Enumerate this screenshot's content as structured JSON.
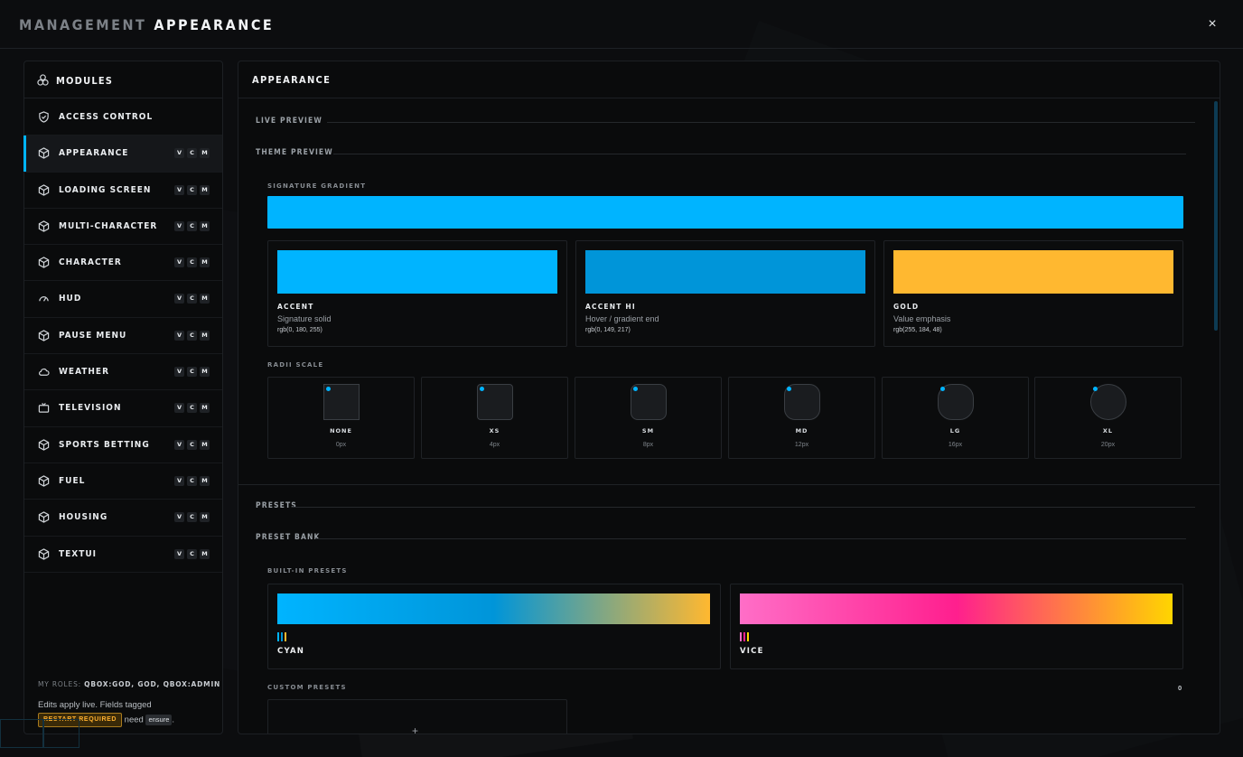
{
  "window": {
    "title_prefix": "MANAGEMENT",
    "title_main": "APPEARANCE",
    "close_label": "×"
  },
  "sidebar": {
    "header": "MODULES",
    "items": [
      {
        "label": "ACCESS CONTROL",
        "icon": "shield-icon",
        "badges": []
      },
      {
        "label": "APPEARANCE",
        "icon": "cube-icon",
        "badges": [
          "V",
          "C",
          "M"
        ],
        "active": true
      },
      {
        "label": "LOADING SCREEN",
        "icon": "cube-icon",
        "badges": [
          "V",
          "C",
          "M"
        ]
      },
      {
        "label": "MULTI-CHARACTER",
        "icon": "cube-icon",
        "badges": [
          "V",
          "C",
          "M"
        ]
      },
      {
        "label": "CHARACTER",
        "icon": "cube-icon",
        "badges": [
          "V",
          "C",
          "M"
        ]
      },
      {
        "label": "HUD",
        "icon": "gauge-icon",
        "badges": [
          "V",
          "C",
          "M"
        ]
      },
      {
        "label": "PAUSE MENU",
        "icon": "cube-icon",
        "badges": [
          "V",
          "C",
          "M"
        ]
      },
      {
        "label": "WEATHER",
        "icon": "cloud-icon",
        "badges": [
          "V",
          "C",
          "M"
        ]
      },
      {
        "label": "TELEVISION",
        "icon": "tv-icon",
        "badges": [
          "V",
          "C",
          "M"
        ]
      },
      {
        "label": "SPORTS BETTING",
        "icon": "cube-icon",
        "badges": [
          "V",
          "C",
          "M"
        ]
      },
      {
        "label": "FUEL",
        "icon": "cube-icon",
        "badges": [
          "V",
          "C",
          "M"
        ]
      },
      {
        "label": "HOUSING",
        "icon": "cube-icon",
        "badges": [
          "V",
          "C",
          "M"
        ]
      },
      {
        "label": "TEXTUI",
        "icon": "cube-icon",
        "badges": [
          "V",
          "C",
          "M"
        ]
      }
    ],
    "roles_label": "MY ROLES:",
    "roles_value": "QBOX:GOD, GOD, QBOX:ADMIN",
    "note_text": "Edits apply live. Fields tagged",
    "restart_badge": "RESTART REQUIRED",
    "note_need": "need",
    "ensure_code": "ensure",
    "note_end": "."
  },
  "main": {
    "header": "APPEARANCE",
    "sections": {
      "live_preview": "LIVE PREVIEW",
      "theme_preview": "THEME PREVIEW",
      "presets": "PRESETS",
      "preset_bank": "PRESET BANK"
    },
    "signature_gradient_label": "SIGNATURE GRADIENT",
    "signature_gradient_color": "#00b4ff",
    "swatches": [
      {
        "name": "ACCENT",
        "desc": "Signature solid",
        "rgb": "rgb(0, 180, 255)",
        "color": "#00b4ff"
      },
      {
        "name": "ACCENT HI",
        "desc": "Hover / gradient end",
        "rgb": "rgb(0, 149, 217)",
        "color": "#0095d9"
      },
      {
        "name": "GOLD",
        "desc": "Value emphasis",
        "rgb": "rgb(255, 184, 48)",
        "color": "#ffb830"
      }
    ],
    "radii_label": "RADII SCALE",
    "radii": [
      {
        "name": "NONE",
        "value": "0px"
      },
      {
        "name": "XS",
        "value": "4px"
      },
      {
        "name": "SM",
        "value": "8px"
      },
      {
        "name": "MD",
        "value": "12px"
      },
      {
        "name": "LG",
        "value": "16px"
      },
      {
        "name": "XL",
        "value": "20px"
      }
    ],
    "builtin_label": "BUILT-IN PRESETS",
    "builtin_presets": [
      {
        "name": "CYAN",
        "colors": [
          "#00b4ff",
          "#0095d9",
          "#ffb830"
        ]
      },
      {
        "name": "VICE",
        "colors": [
          "#ff6ec7",
          "#ff1f8e",
          "#ffd500"
        ]
      }
    ],
    "custom_label": "CUSTOM PRESETS",
    "custom_count": "0",
    "add_label": "+"
  }
}
